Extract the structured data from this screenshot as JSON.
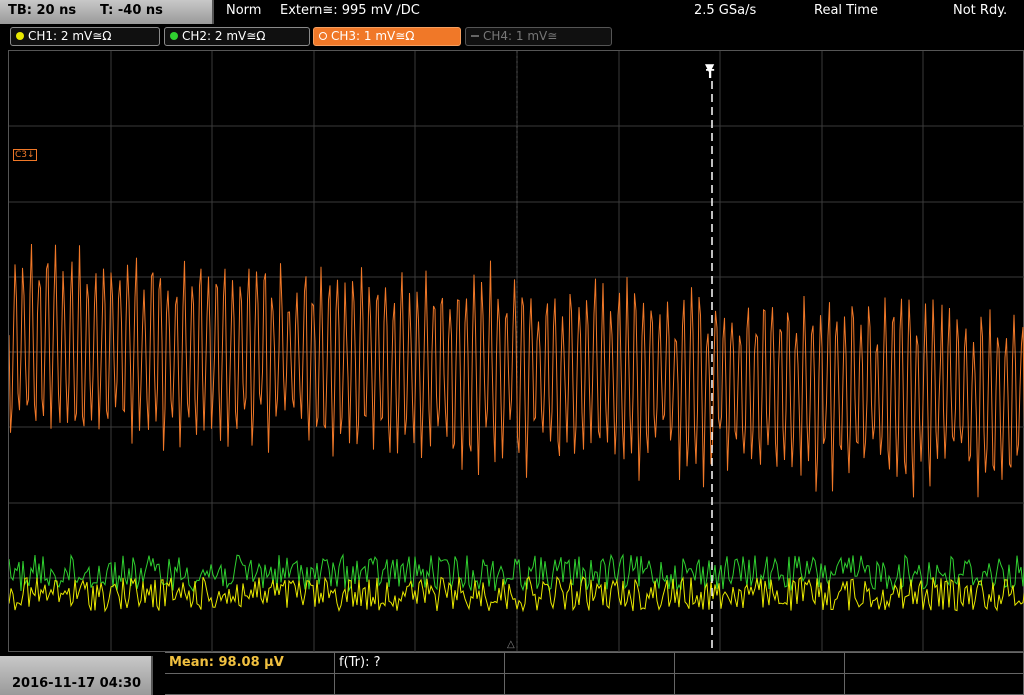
{
  "header": {
    "timebase": "TB: 20 ns",
    "trigger_time": "T: -40 ns",
    "mode": "Norm",
    "trigger_source": "Extern≅: 995 mV ∕DC",
    "sample_rate": "2.5 GSa/s",
    "acq_mode": "Real Time",
    "status": "Not Rdy."
  },
  "channels": [
    {
      "label": "CH1: 2 mV≅Ω",
      "color": "#e8e800",
      "state": "on"
    },
    {
      "label": "CH2: 2 mV≅Ω",
      "color": "#30d030",
      "state": "on"
    },
    {
      "label": "CH3: 1 mV≅Ω",
      "color": "#f07828",
      "state": "active"
    },
    {
      "label": "CH4: 1 mV≅",
      "color": "#666666",
      "state": "off"
    }
  ],
  "markers": {
    "ch3_ref": "C3↓",
    "trigger": "T"
  },
  "measurements": {
    "mean": "Mean: 98.08 μV",
    "freq": "f(Tr): ?"
  },
  "footer": {
    "datetime": "2016-11-17 04:30"
  },
  "colors": {
    "ch1": "#e8e800",
    "ch2": "#30d030",
    "ch3": "#f07828",
    "grid": "#3a3a3a"
  }
}
